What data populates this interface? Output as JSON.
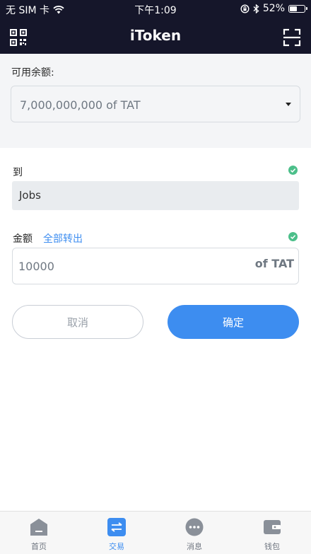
{
  "status_bar": {
    "carrier": "无 SIM 卡",
    "time": "下午1:09",
    "battery_text": "52%",
    "battery_level": 0.52
  },
  "nav": {
    "title": "iToken",
    "left_icon": "qr-code-icon",
    "right_icon": "scan-icon"
  },
  "balance": {
    "label": "可用余额:",
    "value": "7,000,000,000 of TAT"
  },
  "form": {
    "to_label": "到",
    "to_value": "Jobs",
    "amount_label": "金额",
    "all_out_label": "全部转出",
    "amount_value": "10000",
    "amount_unit": "of TAT"
  },
  "buttons": {
    "cancel": "取消",
    "confirm": "确定"
  },
  "tabs": [
    {
      "label": "首页",
      "icon": "home-icon"
    },
    {
      "label": "交易",
      "icon": "transfer-icon",
      "active": true
    },
    {
      "label": "消息",
      "icon": "message-icon"
    },
    {
      "label": "钱包",
      "icon": "wallet-icon"
    }
  ],
  "colors": {
    "header_bg": "#15162a",
    "accent": "#3d8df0",
    "check_green": "#4cbf8a"
  }
}
